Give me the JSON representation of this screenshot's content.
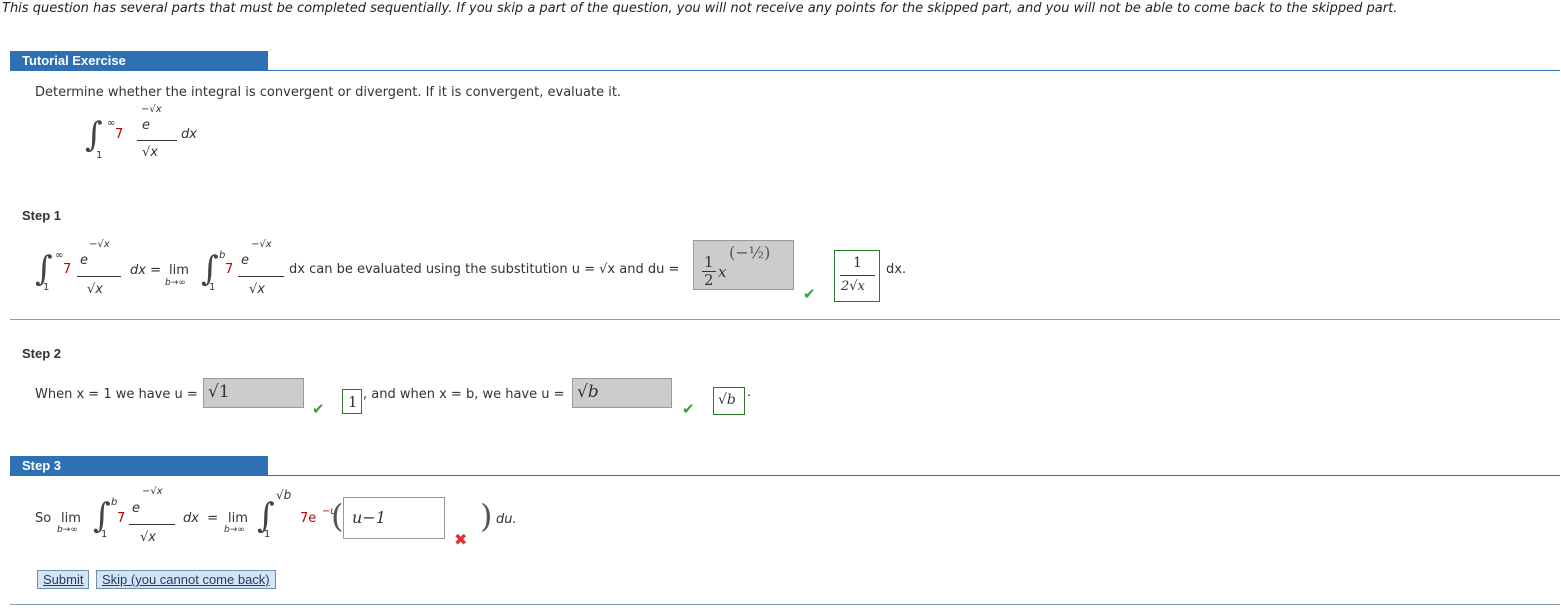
{
  "notice": "This question has several parts that must be completed sequentially. If you skip a part of the question, you will not receive any points for the skipped part, and you will not be able to come back to the skipped part.",
  "tutorial_tab": "Tutorial Exercise",
  "prompt": "Determine whether the integral is convergent or divergent. If it is convergent, evaluate it.",
  "integral": {
    "coef": "7",
    "lower": "1",
    "upper": "∞",
    "numerator": "e",
    "exponent": "−√x",
    "denominator": "√x",
    "dx": "dx"
  },
  "step1": {
    "label": "Step 1",
    "lim": "lim",
    "lim_sub": "b→∞",
    "upper_b": "b",
    "eq": "dx =",
    "text": "dx can be evaluated using the substitution u = √x and du =",
    "input_value_num": "1",
    "input_value_den": "2",
    "input_value_var": "x",
    "input_value_exp": "(−½)",
    "answer_num": "1",
    "answer_den": "2√x",
    "after": "dx."
  },
  "step2": {
    "label": "Step 2",
    "text1": "When x = 1 we have u =",
    "input1": "√1",
    "answer1": "1",
    "text2": ", and when x = b, we have u =",
    "input2": "√b",
    "answer2": "√b",
    "end": "."
  },
  "step3": {
    "label": "Step 3",
    "so": "So",
    "lim": "lim",
    "lim_sub": "b→∞",
    "eq": "dx  =",
    "upper_sqrtb": "√b",
    "integrand": "7e",
    "exp": "−u",
    "input_value": "u−1",
    "du": "du."
  },
  "buttons": {
    "submit": "Submit",
    "skip": "Skip (you cannot come back)"
  },
  "icons": {
    "check": "✔",
    "cross": "✖"
  }
}
